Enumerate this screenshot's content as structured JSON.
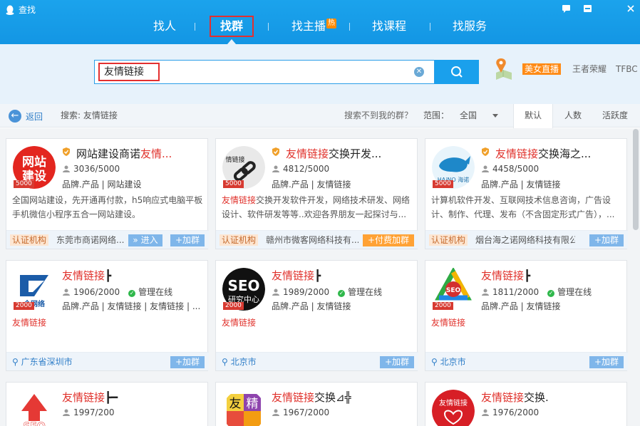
{
  "window": {
    "title": "查找",
    "controls": [
      "msg",
      "min",
      "close"
    ]
  },
  "nav": {
    "tabs": [
      {
        "label": "找人"
      },
      {
        "label": "找群"
      },
      {
        "label": "找主播",
        "badge": "热"
      },
      {
        "label": "找课程"
      },
      {
        "label": "找服务"
      }
    ]
  },
  "search": {
    "value": "友情链接"
  },
  "hot_keywords": {
    "live": "美女直播",
    "k1": "王者荣耀",
    "k2": "TFBC"
  },
  "filter": {
    "back_label": "返回",
    "search_info": "搜索: 友情链接",
    "not_found": "搜索不到我的群？",
    "scope_label": "范围：",
    "scope_value": "全国",
    "sorts": [
      "默认",
      "人数",
      "活跃度"
    ]
  },
  "cards": [
    {
      "name_pre": "网站建设商诺",
      "name_red": "友情...",
      "name_post": "",
      "members": "3036/5000",
      "tags": "品牌.产品 | 网站建设",
      "badge": "5000",
      "desc_red": "",
      "desc": "全国网站建设，先开通再付款，h5响应式电脑平板手机微信小程序五合一网站建设。",
      "org": "认证机构",
      "orgname": "东莞市商诺网络...",
      "btn1": "» 进入",
      "btn2": "+加群"
    },
    {
      "name_pre": "",
      "name_red": "友情链接",
      "name_post": "交换开发...",
      "members": "4812/5000",
      "tags": "品牌.产品 | 友情链接",
      "badge": "5000",
      "desc_red": "友情链接",
      "desc": "交换开发软件开发，网络技术研发、网络设计、软件研发等等..欢迎各界朋友一起探讨与...",
      "org": "认证机构",
      "orgname": "赣州市微客网络科技有...",
      "btn1": "+付费加群"
    },
    {
      "name_pre": "",
      "name_red": "友情链接",
      "name_post": "交换海之...",
      "members": "4458/5000",
      "tags": "品牌.产品 | 友情链接",
      "badge": "5000",
      "desc_red": "",
      "desc": "计算机软件开发、互联网技术信息咨询，广告设计、制作、代理、发布（不含固定形式广告），...",
      "org": "认证机构",
      "orgname": "烟台海之诺网络科技有限公司",
      "btn2": "+加群"
    },
    {
      "name_red": "友情链接",
      "name_post": "┣",
      "members": "1906/2000",
      "status": "管理在线",
      "tags": "品牌.产品 | 友情链接 | 友情链接 | ...",
      "badge": "2000",
      "desc_red": "友情链接",
      "loc": "广东省深圳市",
      "btn2": "+加群"
    },
    {
      "name_red": "友情链接",
      "name_post": "┣",
      "members": "1989/2000",
      "status": "管理在线",
      "tags": "品牌.产品 | 友情链接",
      "badge": "2000",
      "desc_red": "友情链接",
      "loc": "北京市",
      "btn2": "+加群"
    },
    {
      "name_red": "友情链接",
      "name_post": "┣",
      "members": "1811/2000",
      "status": "管理在线",
      "tags": "品牌.产品 | 友情链接",
      "badge": "2000",
      "desc_red": "友情链接",
      "loc": "北京市",
      "btn2": "+加群"
    },
    {
      "name_red": "友情链接",
      "name_post": "┣━",
      "members": "1997/200"
    },
    {
      "name_red": "友情链接",
      "name_post": "交换⊿╬",
      "members": "1967/2000"
    },
    {
      "name_red": "友情链接",
      "name_post": "交换.",
      "members": "1976/2000"
    }
  ],
  "colors": {
    "brand": "#1a9fe8",
    "red": "#e0312b",
    "orange": "#ff8b16",
    "link": "#2f7ec8"
  }
}
